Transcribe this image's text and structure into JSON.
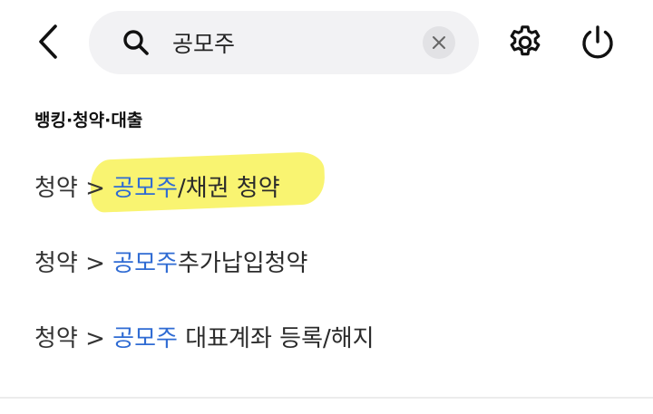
{
  "header": {
    "back_icon": "chevron-left-icon",
    "search": {
      "value": "공모주",
      "icon": "search-icon",
      "clear_icon": "close-icon"
    },
    "settings_icon": "gear-icon",
    "power_icon": "power-icon"
  },
  "section": {
    "title": "뱅킹·청약·대출"
  },
  "results": [
    {
      "crumb": "청약",
      "separator": ">",
      "keyword": "공모주",
      "rest": "/채권 청약",
      "highlighted": true
    },
    {
      "crumb": "청약",
      "separator": ">",
      "keyword": "공모주",
      "rest": "추가납입청약"
    },
    {
      "crumb": "청약",
      "separator": ">",
      "keyword": "공모주",
      "rest": " 대표계좌 등록/해지"
    }
  ],
  "colors": {
    "keyword": "#2f6bd3",
    "highlight": "#f9f471",
    "search_bg": "#f2f2f4",
    "text": "#2b2b2b"
  }
}
